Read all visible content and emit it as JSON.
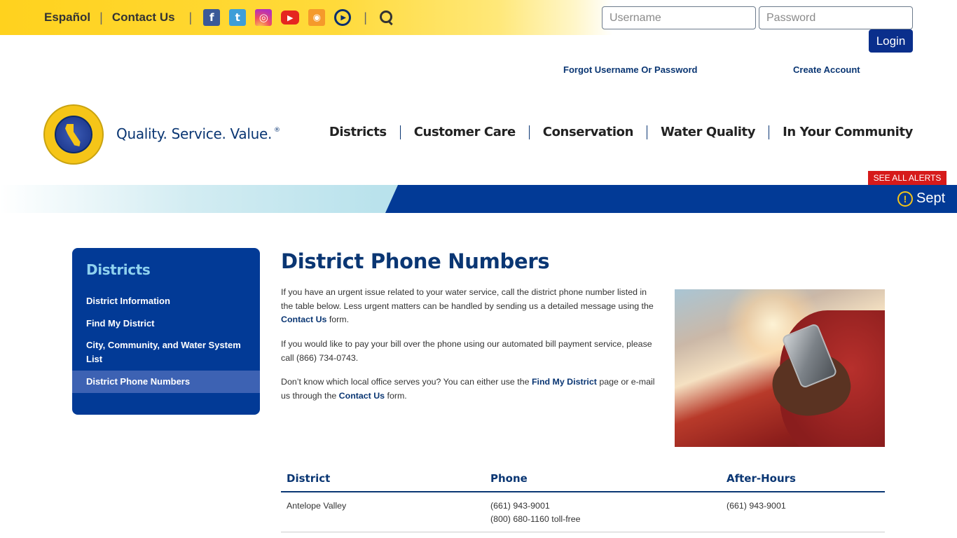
{
  "topbar": {
    "espanol": "Español",
    "contact": "Contact Us",
    "social": [
      {
        "name": "facebook-icon",
        "glyph": "f"
      },
      {
        "name": "twitter-icon",
        "glyph": "t"
      },
      {
        "name": "instagram-icon",
        "glyph": "◎"
      },
      {
        "name": "youtube-icon",
        "glyph": "▶"
      },
      {
        "name": "rss-icon",
        "glyph": "◉"
      },
      {
        "name": "play-circle-icon",
        "glyph": "▶"
      }
    ]
  },
  "login": {
    "username_placeholder": "Username",
    "password_placeholder": "Password",
    "button": "Login",
    "forgot": "Forgot Username Or Password",
    "create": "Create Account"
  },
  "header": {
    "tagline": "Quality. Service. Value.",
    "tagline_mark": "®",
    "nav": [
      "Districts",
      "Customer Care",
      "Conservation",
      "Water Quality",
      "In Your Community"
    ]
  },
  "alerts": {
    "see_all": "SEE ALL ALERTS",
    "ticker": "Sept"
  },
  "sidebar": {
    "title": "Districts",
    "items": [
      {
        "label": "District Information",
        "active": false
      },
      {
        "label": "Find My District",
        "active": false
      },
      {
        "label": "City, Community, and Water System List",
        "active": false
      },
      {
        "label": "District Phone Numbers",
        "active": true
      }
    ]
  },
  "main": {
    "title": "District Phone Numbers",
    "p1_before": "If you have an urgent issue related to your water service, call the district phone number listed in the table below. Less urgent matters can be handled by sending us a detailed message using the ",
    "p1_link": "Contact Us",
    "p1_after": " form.",
    "p2": "If you would like to pay your bill over the phone using our automated bill payment service, please call (866) 734-0743.",
    "p3_before": "Don’t know which local office serves you? You can either use the ",
    "p3_link1": "Find My District",
    "p3_mid": " page or e-mail us through the ",
    "p3_link2": "Contact Us",
    "p3_after": " form."
  },
  "table": {
    "headers": [
      "District",
      "Phone",
      "After-Hours"
    ],
    "rows": [
      {
        "district": "Antelope Valley",
        "phone1": "(661) 943-9001",
        "phone2": "(800) 680-1160 toll-free",
        "after": "(661) 943-9001"
      }
    ]
  },
  "colors": {
    "brand_blue": "#023a96",
    "accent_yellow": "#ffd21e",
    "alert_red": "#d61a1a"
  }
}
